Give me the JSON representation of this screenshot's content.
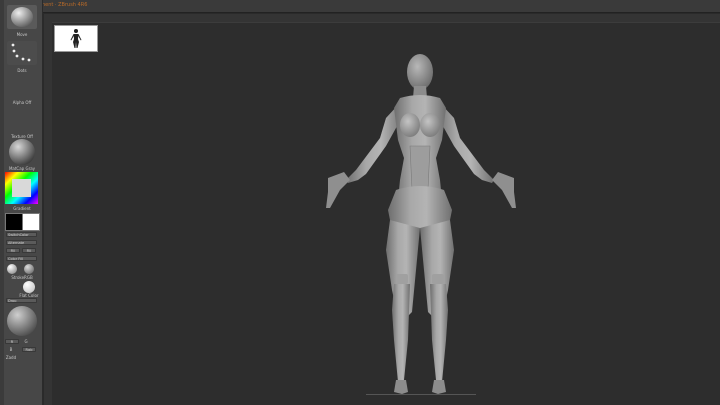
{
  "app": {
    "title_text": "ZBrush  Document  ·  ZBrush 4R6",
    "accent_color": "#b86a28"
  },
  "left_shelf": {
    "brush_label": "Move",
    "stroke_label": "Dots",
    "alpha_label": "Alpha Off",
    "texture_label": "Texture Off",
    "material_label": "MatCap Gray",
    "gradient_label": "Gradient",
    "switch_color_label": "SwitchColor",
    "alternate_label": "Alternate",
    "fill_label": "Fill",
    "fill2_label": "Fill",
    "color_fill_label": "Color Fill",
    "stroke_rgb_label": "StrokeRGB",
    "use_label": "Use",
    "flat_color_label": "Flat Color",
    "drop_label": "Drop",
    "sphere_label": "SphereBrush",
    "r_label": "R",
    "g_label": "G",
    "b_label": "B",
    "rgb_label": "Rgb",
    "zadd_label": "Zadd",
    "icons": [
      "brush-sphere-icon",
      "stroke-dots-icon",
      "alpha-off-icon",
      "texture-off-icon",
      "matcap-sphere-icon",
      "color-picker-icon"
    ]
  },
  "canvas": {
    "background_color": "#2d2d2d",
    "model_color": "#9a9a9a"
  }
}
